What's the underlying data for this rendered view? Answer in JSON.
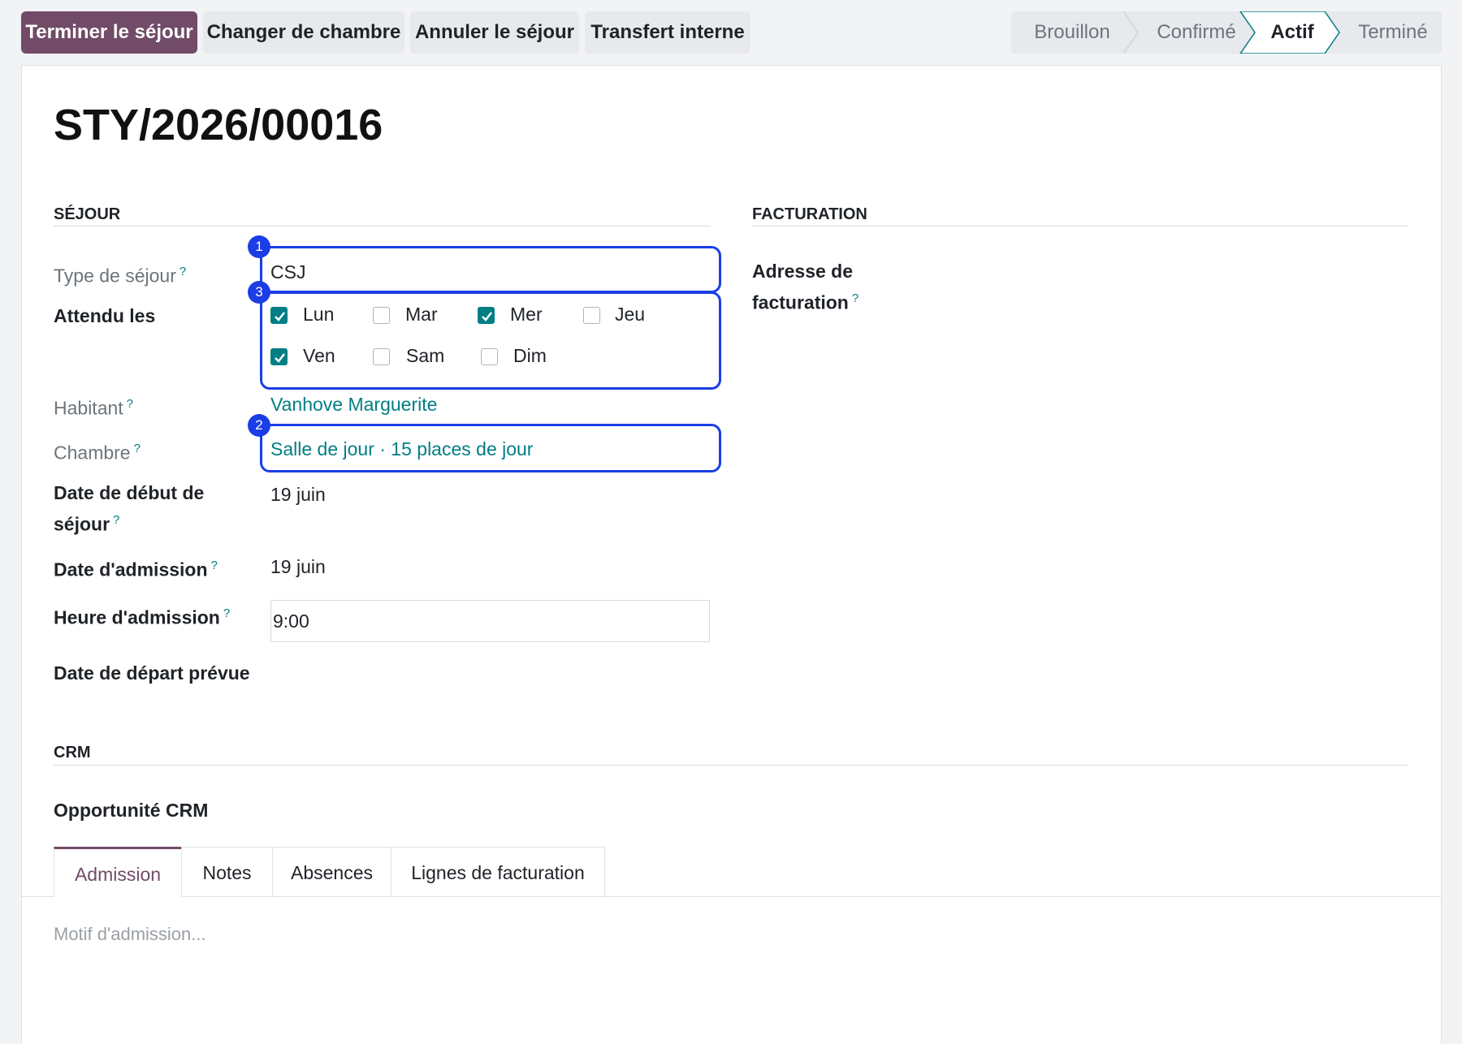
{
  "actions": {
    "finish_stay": "Terminer le séjour",
    "change_room": "Changer de chambre",
    "cancel_stay": "Annuler le séjour",
    "internal_transfer": "Transfert interne"
  },
  "statusbar": {
    "stages": [
      "Brouillon",
      "Confirmé",
      "Actif",
      "Terminé"
    ],
    "active": "Actif"
  },
  "record": {
    "title": "STY/2026/00016"
  },
  "sections": {
    "stay": "SÉJOUR",
    "billing": "FACTURATION",
    "crm": "CRM"
  },
  "fields": {
    "stay_type": {
      "label": "Type de séjour",
      "help": "?",
      "value": "CSJ"
    },
    "expected_days": {
      "label": "Attendu les",
      "days": [
        {
          "name": "Lun",
          "checked": true
        },
        {
          "name": "Mar",
          "checked": false
        },
        {
          "name": "Mer",
          "checked": true
        },
        {
          "name": "Jeu",
          "checked": false
        },
        {
          "name": "Ven",
          "checked": true
        },
        {
          "name": "Sam",
          "checked": false
        },
        {
          "name": "Dim",
          "checked": false
        }
      ]
    },
    "resident": {
      "label": "Habitant",
      "help": "?",
      "value": "Vanhove Marguerite"
    },
    "room": {
      "label": "Chambre",
      "help": "?",
      "value": "Salle de jour · 15 places de jour"
    },
    "start_date": {
      "label_line1": "Date de début de",
      "label_line2": "séjour",
      "help": "?",
      "value": "19 juin"
    },
    "admission_date": {
      "label": "Date d'admission",
      "help": "?",
      "value": "19 juin"
    },
    "admission_time": {
      "label": "Heure d'admission",
      "help": "?",
      "value": "9:00"
    },
    "planned_departure": {
      "label": "Date de départ prévue",
      "value": ""
    },
    "billing_address": {
      "label_line1": "Adresse de",
      "label_line2": "facturation",
      "help": "?"
    },
    "crm_opportunity": {
      "label": "Opportunité CRM"
    }
  },
  "annotations": [
    "1",
    "2",
    "3"
  ],
  "tabs": [
    "Admission",
    "Notes",
    "Absences",
    "Lignes de facturation"
  ],
  "admission_tab": {
    "placeholder": "Motif d'admission..."
  },
  "colors": {
    "primary": "#714b67",
    "teal": "#017e84",
    "highlight": "#1a3de6"
  }
}
